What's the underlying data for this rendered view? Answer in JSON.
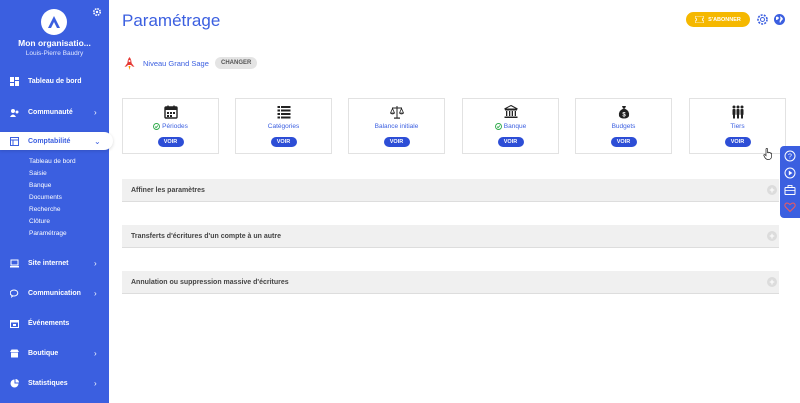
{
  "sidebar": {
    "org_name": "Mon organisatio...",
    "user_name": "Louis-Pierre Baudry",
    "items": [
      {
        "label": "Tableau de bord",
        "icon": "dashboard-icon",
        "has_chevron": false
      },
      {
        "label": "Communauté",
        "icon": "community-icon",
        "has_chevron": true
      },
      {
        "label": "Comptabilité",
        "icon": "accounting-icon",
        "has_chevron": true,
        "active": true
      },
      {
        "label": "Site internet",
        "icon": "laptop-icon",
        "has_chevron": true
      },
      {
        "label": "Communication",
        "icon": "chat-icon",
        "has_chevron": true
      },
      {
        "label": "Événements",
        "icon": "calendar-icon",
        "has_chevron": false
      },
      {
        "label": "Boutique",
        "icon": "shop-icon",
        "has_chevron": true
      },
      {
        "label": "Statistiques",
        "icon": "stats-icon",
        "has_chevron": true
      }
    ],
    "sub_items": [
      "Tableau de bord",
      "Saisie",
      "Banque",
      "Documents",
      "Recherche",
      "Clôture",
      "Paramétrage"
    ]
  },
  "header": {
    "title": "Paramétrage",
    "subscribe_label": "S'ABONNER"
  },
  "level": {
    "text": "Niveau Grand Sage",
    "change_label": "CHANGER"
  },
  "cards": [
    {
      "label": "Périodes",
      "checked": true,
      "icon": "calendar-icon",
      "button": "VOIR"
    },
    {
      "label": "Catégories",
      "checked": false,
      "icon": "list-icon",
      "button": "VOIR"
    },
    {
      "label": "Balance initiale",
      "checked": false,
      "icon": "scale-icon",
      "button": "VOIR"
    },
    {
      "label": "Banque",
      "checked": true,
      "icon": "bank-icon",
      "button": "VOIR"
    },
    {
      "label": "Budgets",
      "checked": false,
      "icon": "money-bag-icon",
      "button": "VOIR"
    },
    {
      "label": "Tiers",
      "checked": false,
      "icon": "people-icon",
      "button": "VOIR"
    }
  ],
  "panels": [
    {
      "title": "Affiner les paramètres"
    },
    {
      "title": "Transferts d'écritures d'un compte à un autre"
    },
    {
      "title": "Annulation ou suppression massive d'écritures"
    }
  ],
  "colors": {
    "primary": "#3b5fe0",
    "button": "#2d4ed6",
    "subscribe": "#f5b800",
    "check": "#2eaa4a"
  }
}
